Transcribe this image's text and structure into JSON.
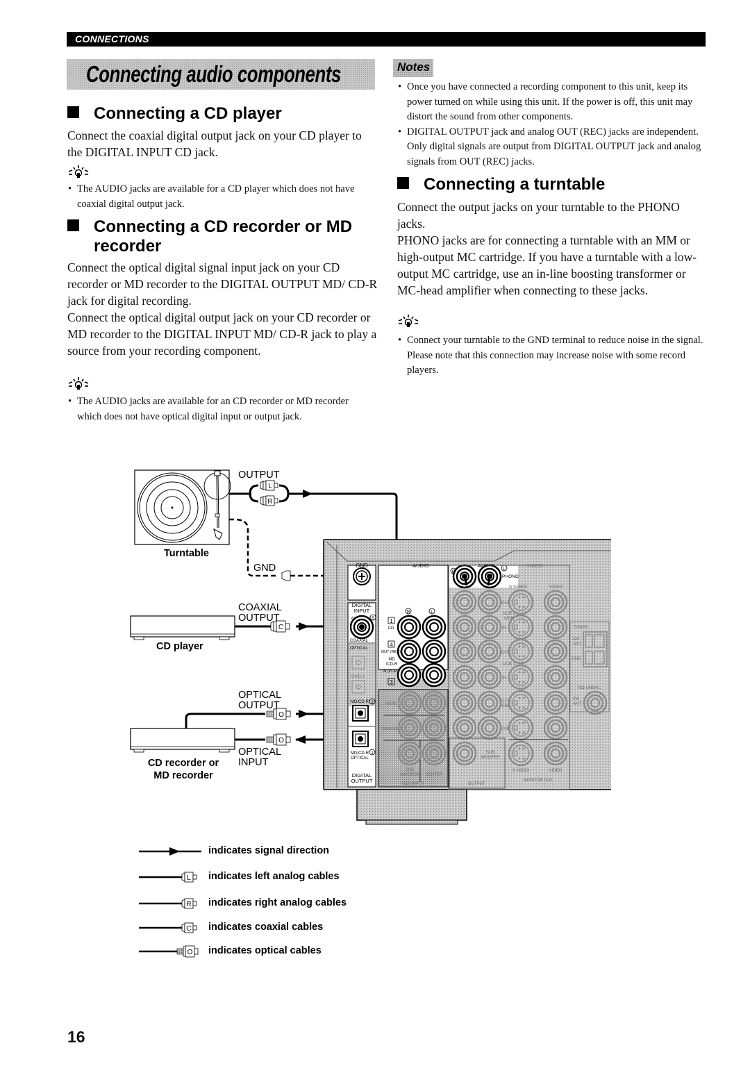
{
  "header": {
    "section_label": "CONNECTIONS",
    "page_title": "Connecting audio components"
  },
  "left_column": {
    "cd_player": {
      "heading": "Connecting a CD player",
      "body": "Connect the coaxial digital output jack on your CD player to the DIGITAL INPUT CD jack.",
      "tip_icon": "lightbulb-tip-icon",
      "tip": "The AUDIO jacks are available for a CD player which does not have coaxial digital output jack."
    },
    "cd_recorder": {
      "heading_line1": "Connecting a CD recorder or MD",
      "heading_line2": "recorder",
      "body1": "Connect the optical digital signal input jack on your CD recorder or MD recorder to the DIGITAL OUTPUT MD/ CD-R jack for digital recording.",
      "body2": "Connect the optical digital output jack on your CD recorder or MD recorder to the DIGITAL INPUT MD/ CD-R jack to play a source from your recording component.",
      "tip_icon": "lightbulb-tip-icon",
      "tip": "The AUDIO jacks are available for an CD recorder or MD recorder which does not have optical digital input or output jack."
    }
  },
  "right_column": {
    "notes": {
      "label": "Notes",
      "items": [
        "Once you have connected a recording component to this unit, keep its power turned on while using this unit. If the power is off, this unit may distort the sound from other components.",
        "DIGITAL OUTPUT jack and analog OUT (REC) jacks are independent. Only digital signals are output from DIGITAL OUTPUT jack and analog signals from OUT (REC) jacks."
      ]
    },
    "turntable": {
      "heading": "Connecting a turntable",
      "body1": "Connect the output jacks on your turntable to the PHONO jacks.",
      "body2": "PHONO jacks are for connecting a turntable with an MM or high-output MC cartridge. If you have a turntable with a low-output MC cartridge, use an in-line boosting transformer or MC-head amplifier when connecting to these jacks.",
      "tip_icon": "lightbulb-tip-icon",
      "tip": "Connect your turntable to the GND terminal to reduce noise in the signal. Please note that this connection may increase noise with some record players."
    }
  },
  "diagram": {
    "devices": {
      "turntable": "Turntable",
      "cd_player": "CD player",
      "cd_recorder_line1": "CD recorder or",
      "cd_recorder_line2": "MD recorder"
    },
    "connectors": {
      "output": "OUTPUT",
      "gnd": "GND",
      "coaxial_output_line1": "COAXIAL",
      "coaxial_output_line2": "OUTPUT",
      "optical_output_line1": "OPTICAL",
      "optical_output_line2": "OUTPUT",
      "optical_input_line1": "OPTICAL",
      "optical_input_line2": "INPUT"
    },
    "plug_letters": {
      "left": "L",
      "right": "R",
      "coaxial": "C",
      "optical": "O"
    },
    "receiver_labels": {
      "gnd": "GND",
      "audio1": "AUDIO",
      "audio2": "AUDIO",
      "video": "VIDEO",
      "phono": "PHONO",
      "r": "R",
      "l": "L",
      "digital_input_line1": "DIGITAL",
      "digital_input_line2": "INPUT",
      "cd": "CD",
      "n5": "5",
      "coaxial": "COAXIAL",
      "optical": "OPTICAL",
      "dtv_cbl": "D.TV/CBL 4",
      "dvd": "DVD 3",
      "mdcdr2": "MD/CD-R",
      "n2": "2",
      "mdcdr1": "MD/CD-R",
      "n1": "1",
      "optical2": "OPTICAL",
      "digital_output_line1": "DIGITAL",
      "digital_output_line2": "OUTPUT",
      "cd_row": "CD",
      "n1box": "1",
      "out_rec": "OUT (REC)",
      "n4box": "4",
      "mdcdr_line1": "MD",
      "mdcdr_line2": "/CD-R",
      "in_play": "IN (PLAY)",
      "n3box": "3",
      "main": "MAIN",
      "surround": "SURROUND",
      "sub_woofer_line1": "SUB",
      "sub_woofer_line2": "WOOFER",
      "center": "CENTER",
      "ch6_input": "6CH INPUT",
      "output": "OUTPUT",
      "sub_woofer_out_line1": "SUB",
      "sub_woofer_out_line2": "WOOFER",
      "s_video_hdr": "S VIDEO",
      "video_hdr": "VIDEO",
      "out": "OUT",
      "in": "IN",
      "vcr2_line1": "VCR 2",
      "vcr2_line2": "/VDR",
      "vcr1": "VCR 1",
      "dtv_line1": "D.TV",
      "dtv_line2": "/CBL",
      "dvd_row": "DVD",
      "s_video_mon": "S VIDEO",
      "video_mon": "VIDEO",
      "monitor_out": "MONITOR OUT",
      "tuner": "TUNER",
      "am_ant_line1": "AM",
      "am_ant_line2": "ANT",
      "gnd_tuner": "GND",
      "unbal": "75Ω UNBAL.",
      "fm_ant_line1": "FM",
      "fm_ant_line2": "ANT"
    }
  },
  "legend": [
    {
      "icon": "signal-direction-arrow-icon",
      "label": "indicates signal direction"
    },
    {
      "icon": "left-analog-plug-icon",
      "letter": "L",
      "label": "indicates left analog cables"
    },
    {
      "icon": "right-analog-plug-icon",
      "letter": "R",
      "label": "indicates right analog cables"
    },
    {
      "icon": "coaxial-plug-icon",
      "letter": "C",
      "label": "indicates coaxial cables"
    },
    {
      "icon": "optical-plug-icon",
      "letter": "O",
      "label": "indicates optical cables"
    }
  ],
  "footer": {
    "page_number": "16"
  }
}
